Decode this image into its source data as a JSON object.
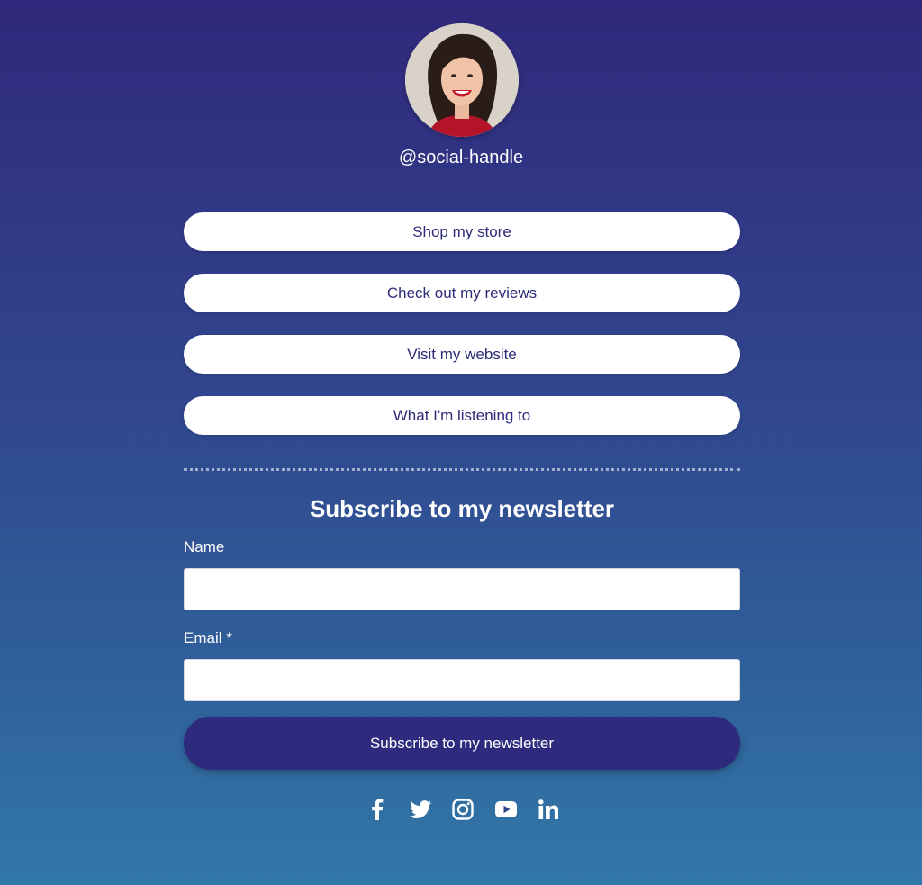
{
  "profile": {
    "handle": "@social-handle"
  },
  "links": [
    {
      "label": "Shop my store"
    },
    {
      "label": "Check out my reviews"
    },
    {
      "label": "Visit my website"
    },
    {
      "label": "What I'm listening to"
    }
  ],
  "newsletter": {
    "title": "Subscribe to my newsletter",
    "name_label": "Name",
    "name_value": "",
    "email_label": "Email *",
    "email_value": "",
    "submit_label": "Subscribe to my newsletter"
  },
  "socials": [
    {
      "icon": "facebook-icon"
    },
    {
      "icon": "twitter-icon"
    },
    {
      "icon": "instagram-icon"
    },
    {
      "icon": "youtube-icon"
    },
    {
      "icon": "linkedin-icon"
    }
  ],
  "colors": {
    "background_top": "#30287c",
    "background_bottom": "#3278a8",
    "accent": "#2e2a7e",
    "button_bg": "#ffffff"
  }
}
